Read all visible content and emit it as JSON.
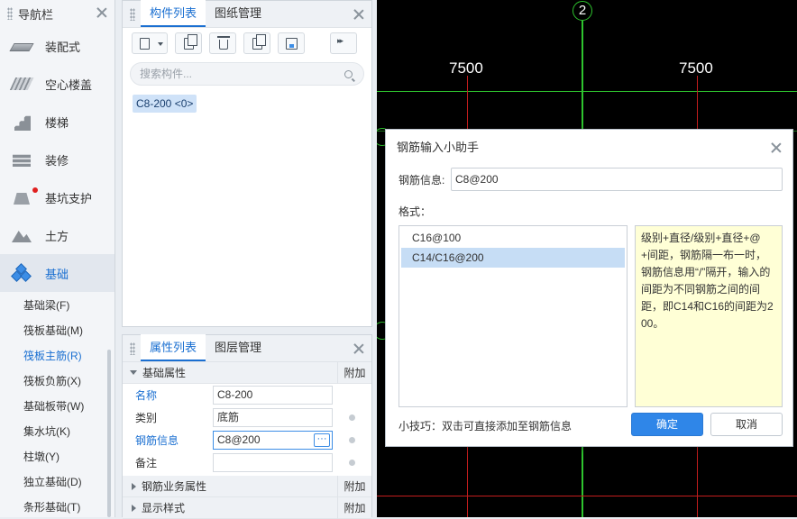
{
  "nav": {
    "title": "导航栏",
    "categories": [
      {
        "label": "装配式",
        "icon": "prefab-icon"
      },
      {
        "label": "空心楼盖",
        "icon": "hollow-slab-icon"
      },
      {
        "label": "楼梯",
        "icon": "stairs-icon"
      },
      {
        "label": "装修",
        "icon": "decoration-icon"
      },
      {
        "label": "基坑支护",
        "icon": "pit-support-icon"
      },
      {
        "label": "土方",
        "icon": "earthwork-icon"
      },
      {
        "label": "基础",
        "icon": "foundation-icon"
      }
    ],
    "subitems": [
      "基础梁(F)",
      "筏板基础(M)",
      "筏板主筋(R)",
      "筏板负筋(X)",
      "基础板带(W)",
      "集水坑(K)",
      "柱墩(Y)",
      "独立基础(D)",
      "条形基础(T)"
    ]
  },
  "component_panel": {
    "tabs": [
      "构件列表",
      "图纸管理"
    ],
    "search_placeholder": "搜索构件...",
    "items": [
      "C8-200 <0>"
    ]
  },
  "property_panel": {
    "tabs": [
      "属性列表",
      "图层管理"
    ],
    "group_basic": "基础属性",
    "extra_header": "附加",
    "rows": [
      {
        "label": "名称",
        "value": "C8-200"
      },
      {
        "label": "类别",
        "value": "底筋"
      },
      {
        "label": "钢筋信息",
        "value": "C8@200"
      },
      {
        "label": "备注",
        "value": ""
      }
    ],
    "group_business": "钢筋业务属性",
    "group_display": "显示样式"
  },
  "cad": {
    "axis_label": "2",
    "dim_left": "7500",
    "dim_right": "7500"
  },
  "dialog": {
    "title": "钢筋输入小助手",
    "rebar_label": "钢筋信息:",
    "rebar_value": "C8@200",
    "format_label": "格式：",
    "formats": [
      "C16@100",
      "C14/C16@200"
    ],
    "selected_format": "C14/C16@200",
    "help_text": "级别+直径/级别+直径+@+间距，钢筋隔一布一时，钢筋信息用“/”隔开，输入的间距为不同钢筋之间的间距，即C14和C16的间距为200。",
    "tip": "小技巧：双击可直接添加至钢筋信息",
    "ok_label": "确定",
    "cancel_label": "取消"
  }
}
